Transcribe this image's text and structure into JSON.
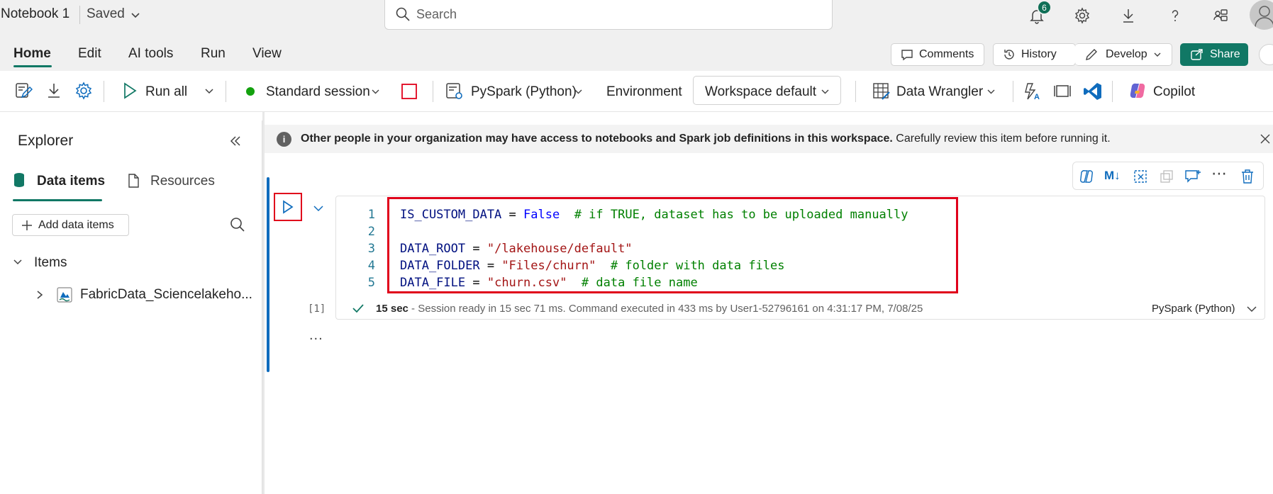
{
  "titlebar": {
    "notebook_name": "Notebook 1",
    "save_state": "Saved",
    "search_placeholder": "Search",
    "notification_count": "6"
  },
  "menu_tabs": [
    "Home",
    "Edit",
    "AI tools",
    "Run",
    "View"
  ],
  "header_buttons": {
    "comments": "Comments",
    "history": "History",
    "develop": "Develop",
    "share": "Share"
  },
  "toolbar": {
    "run_all": "Run all",
    "session": "Standard session",
    "language": "PySpark (Python)",
    "environment_label": "Environment",
    "environment_value": "Workspace default",
    "data_wrangler": "Data Wrangler",
    "copilot": "Copilot"
  },
  "explorer": {
    "title": "Explorer",
    "tabs": [
      "Data items",
      "Resources"
    ],
    "add_button": "Add data items",
    "section": "Items",
    "items": [
      "FabricData_Sciencelakeho..."
    ]
  },
  "info_banner": {
    "bold_text": "Other people in your organization may have access to notebooks and Spark job definitions in this workspace.",
    "text": " Carefully review this item before running it."
  },
  "cell": {
    "exec_count": "[1]",
    "lines": [
      {
        "n": "1",
        "parts": [
          [
            "var",
            "IS_CUSTOM_DATA"
          ],
          [
            "op",
            " = "
          ],
          [
            "kw",
            "False"
          ],
          [
            "op",
            "  "
          ],
          [
            "cm",
            "# if TRUE, dataset has to be uploaded manually"
          ]
        ]
      },
      {
        "n": "2",
        "parts": []
      },
      {
        "n": "3",
        "parts": [
          [
            "var",
            "DATA_ROOT"
          ],
          [
            "op",
            " = "
          ],
          [
            "str",
            "\"/lakehouse/default\""
          ]
        ]
      },
      {
        "n": "4",
        "parts": [
          [
            "var",
            "DATA_FOLDER"
          ],
          [
            "op",
            " = "
          ],
          [
            "str",
            "\"Files/churn\""
          ],
          [
            "op",
            "  "
          ],
          [
            "cm",
            "# folder with data files"
          ]
        ]
      },
      {
        "n": "5",
        "parts": [
          [
            "var",
            "DATA_FILE"
          ],
          [
            "op",
            " = "
          ],
          [
            "str",
            "\"churn.csv\""
          ],
          [
            "op",
            "  "
          ],
          [
            "cm",
            "# data file name"
          ]
        ]
      }
    ],
    "status_duration": "15 sec",
    "status_text": " - Session ready in 15 sec 71 ms. Command executed in 433 ms by User1-52796161 on 4:31:17 PM, 7/08/25",
    "language": "PySpark (Python)",
    "more_dots": "..."
  },
  "colors": {
    "accent": "#117865",
    "highlight_red": "#e0001b",
    "cell_accent": "#0f6cbd"
  }
}
